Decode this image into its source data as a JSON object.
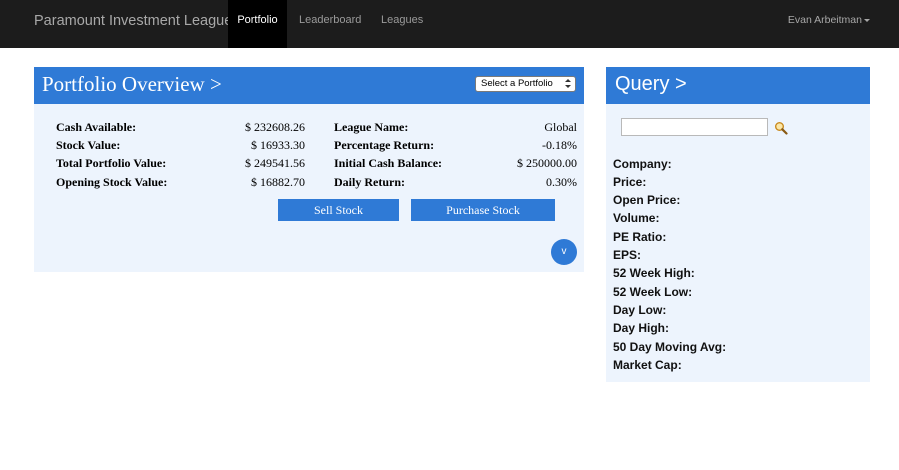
{
  "navbar": {
    "brand": "Paramount Investment League",
    "items": [
      {
        "label": "Portfolio",
        "active": true
      },
      {
        "label": "Leaderboard",
        "active": false
      },
      {
        "label": "Leagues",
        "active": false
      }
    ],
    "user": "Evan Arbeitman"
  },
  "portfolio": {
    "title": "Portfolio Overview >",
    "select_value": "Select a Portfolio",
    "left_stats": [
      {
        "label": "Cash Available:",
        "value": "$ 232608.26"
      },
      {
        "label": "Stock Value:",
        "value": "$ 16933.30"
      },
      {
        "label": "Total Portfolio Value:",
        "value": "$ 249541.56"
      },
      {
        "label": "Opening Stock Value:",
        "value": "$ 16882.70"
      }
    ],
    "right_stats": [
      {
        "label": "League Name:",
        "value": "Global"
      },
      {
        "label": "Percentage Return:",
        "value": "-0.18%"
      },
      {
        "label": "Initial Cash Balance:",
        "value": "$ 250000.00"
      },
      {
        "label": "Daily Return:",
        "value": "0.30%"
      }
    ],
    "sell_label": "Sell Stock",
    "purchase_label": "Purchase Stock",
    "expand_label": "v"
  },
  "query": {
    "title": "Query >",
    "input_value": "",
    "fields": [
      "Company:",
      "Price:",
      "Open Price:",
      "Volume:",
      "PE Ratio:",
      "EPS:",
      "52 Week High:",
      "52 Week Low:",
      "Day Low:",
      "Day High:",
      "50 Day Moving Avg:",
      "Market Cap:"
    ]
  },
  "colors": {
    "navbar_bg": "#1c1c1c",
    "accent_blue": "#2f7ad6",
    "panel_bg": "#edf4fd"
  },
  "icons": {
    "search": "magnifier-icon",
    "caret": "caret-down-icon",
    "select": "select-arrows-icon"
  }
}
